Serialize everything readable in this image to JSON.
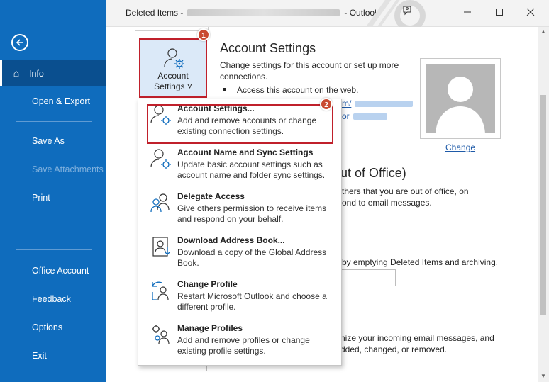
{
  "window": {
    "title_left": "Deleted Items -",
    "title_right": "- Outlook"
  },
  "sidebar": {
    "back_icon": "back-arrow-icon",
    "items": [
      {
        "label": "Info",
        "active": true,
        "icon": "home-icon"
      },
      {
        "label": "Open & Export"
      },
      {
        "label": "Save As"
      },
      {
        "label": "Save Attachments",
        "disabled": true
      },
      {
        "label": "Print"
      },
      {
        "label": "Office Account"
      },
      {
        "label": "Feedback"
      },
      {
        "label": "Options"
      },
      {
        "label": "Exit"
      }
    ]
  },
  "main": {
    "account_button": {
      "line1": "Account",
      "line2": "Settings ˅",
      "icon": "person-gear-icon"
    },
    "badge1": "1",
    "badge2": "2",
    "heading": "Account Settings",
    "description": "Change settings for this account or set up more connections.",
    "bullet": "Access this account on the web.",
    "link_fragment_1": "m/",
    "link_fragment_2": "or",
    "change_link": "Change",
    "ooo_heading_fragment": "ut of Office)",
    "ooo_text_1": "thers that you are out of office, on",
    "ooo_text_2": "ond to email messages.",
    "cleanup_text": "by emptying Deleted Items and archiving.",
    "rules_text_1": "nize your incoming email messages, and",
    "rules_text_2": "dded, changed, or removed."
  },
  "menu": {
    "items": [
      {
        "title": "Account Settings...",
        "desc": "Add and remove accounts or change existing connection settings.",
        "icon": "person-gear-icon"
      },
      {
        "title": "Account Name and Sync Settings",
        "desc": "Update basic account settings such as account name and folder sync settings.",
        "icon": "person-gear-icon"
      },
      {
        "title": "Delegate Access",
        "desc": "Give others permission to receive items and respond on your behalf.",
        "icon": "delegate-people-icon"
      },
      {
        "title": "Download Address Book...",
        "desc": "Download a copy of the Global Address Book.",
        "icon": "address-book-icon"
      },
      {
        "title": "Change Profile",
        "desc": "Restart Microsoft Outlook and choose a different profile.",
        "icon": "change-profile-icon"
      },
      {
        "title": "Manage Profiles",
        "desc": "Add and remove profiles or change existing profile settings.",
        "icon": "manage-profiles-icon"
      }
    ]
  },
  "colors": {
    "sidebar": "#0f6cbd",
    "sidebar_active": "#0a4f8f",
    "highlight_red": "#c0202b",
    "badge": "#c94a31",
    "link": "#1e5aa8"
  }
}
